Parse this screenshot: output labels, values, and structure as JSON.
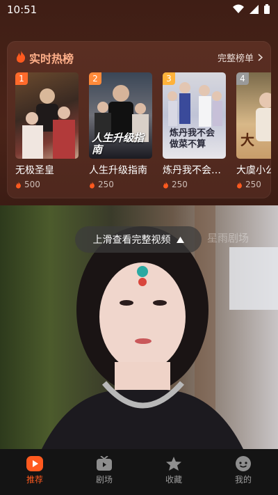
{
  "status": {
    "time": "10:51"
  },
  "hot": {
    "title": "实时热榜",
    "full_rank": "完整榜单",
    "items": [
      {
        "rank": "1",
        "title": "无极圣皇",
        "heat": "500",
        "badge_color": "#ff6a2b"
      },
      {
        "rank": "2",
        "title": "人生升级指南",
        "heat": "250",
        "badge_color": "#ff8a3a"
      },
      {
        "rank": "3",
        "title": "炼丹我不会…",
        "heat": "250",
        "badge_color": "#ffb23a"
      },
      {
        "rank": "4",
        "title": "大虞小公",
        "heat": "250",
        "badge_color": "#9a9a9a"
      }
    ],
    "posters": {
      "p2": "人生升级指南",
      "p3": "炼丹我不会做菜不算"
    }
  },
  "video": {
    "tip": "上滑查看完整视频",
    "watermark": "星雨剧场"
  },
  "tabs": [
    {
      "label": "推荐",
      "active": true
    },
    {
      "label": "剧场",
      "active": false
    },
    {
      "label": "收藏",
      "active": false
    },
    {
      "label": "我的",
      "active": false
    }
  ],
  "colors": {
    "accent": "#ff5a1f",
    "hot_title": "#ffb08a"
  }
}
